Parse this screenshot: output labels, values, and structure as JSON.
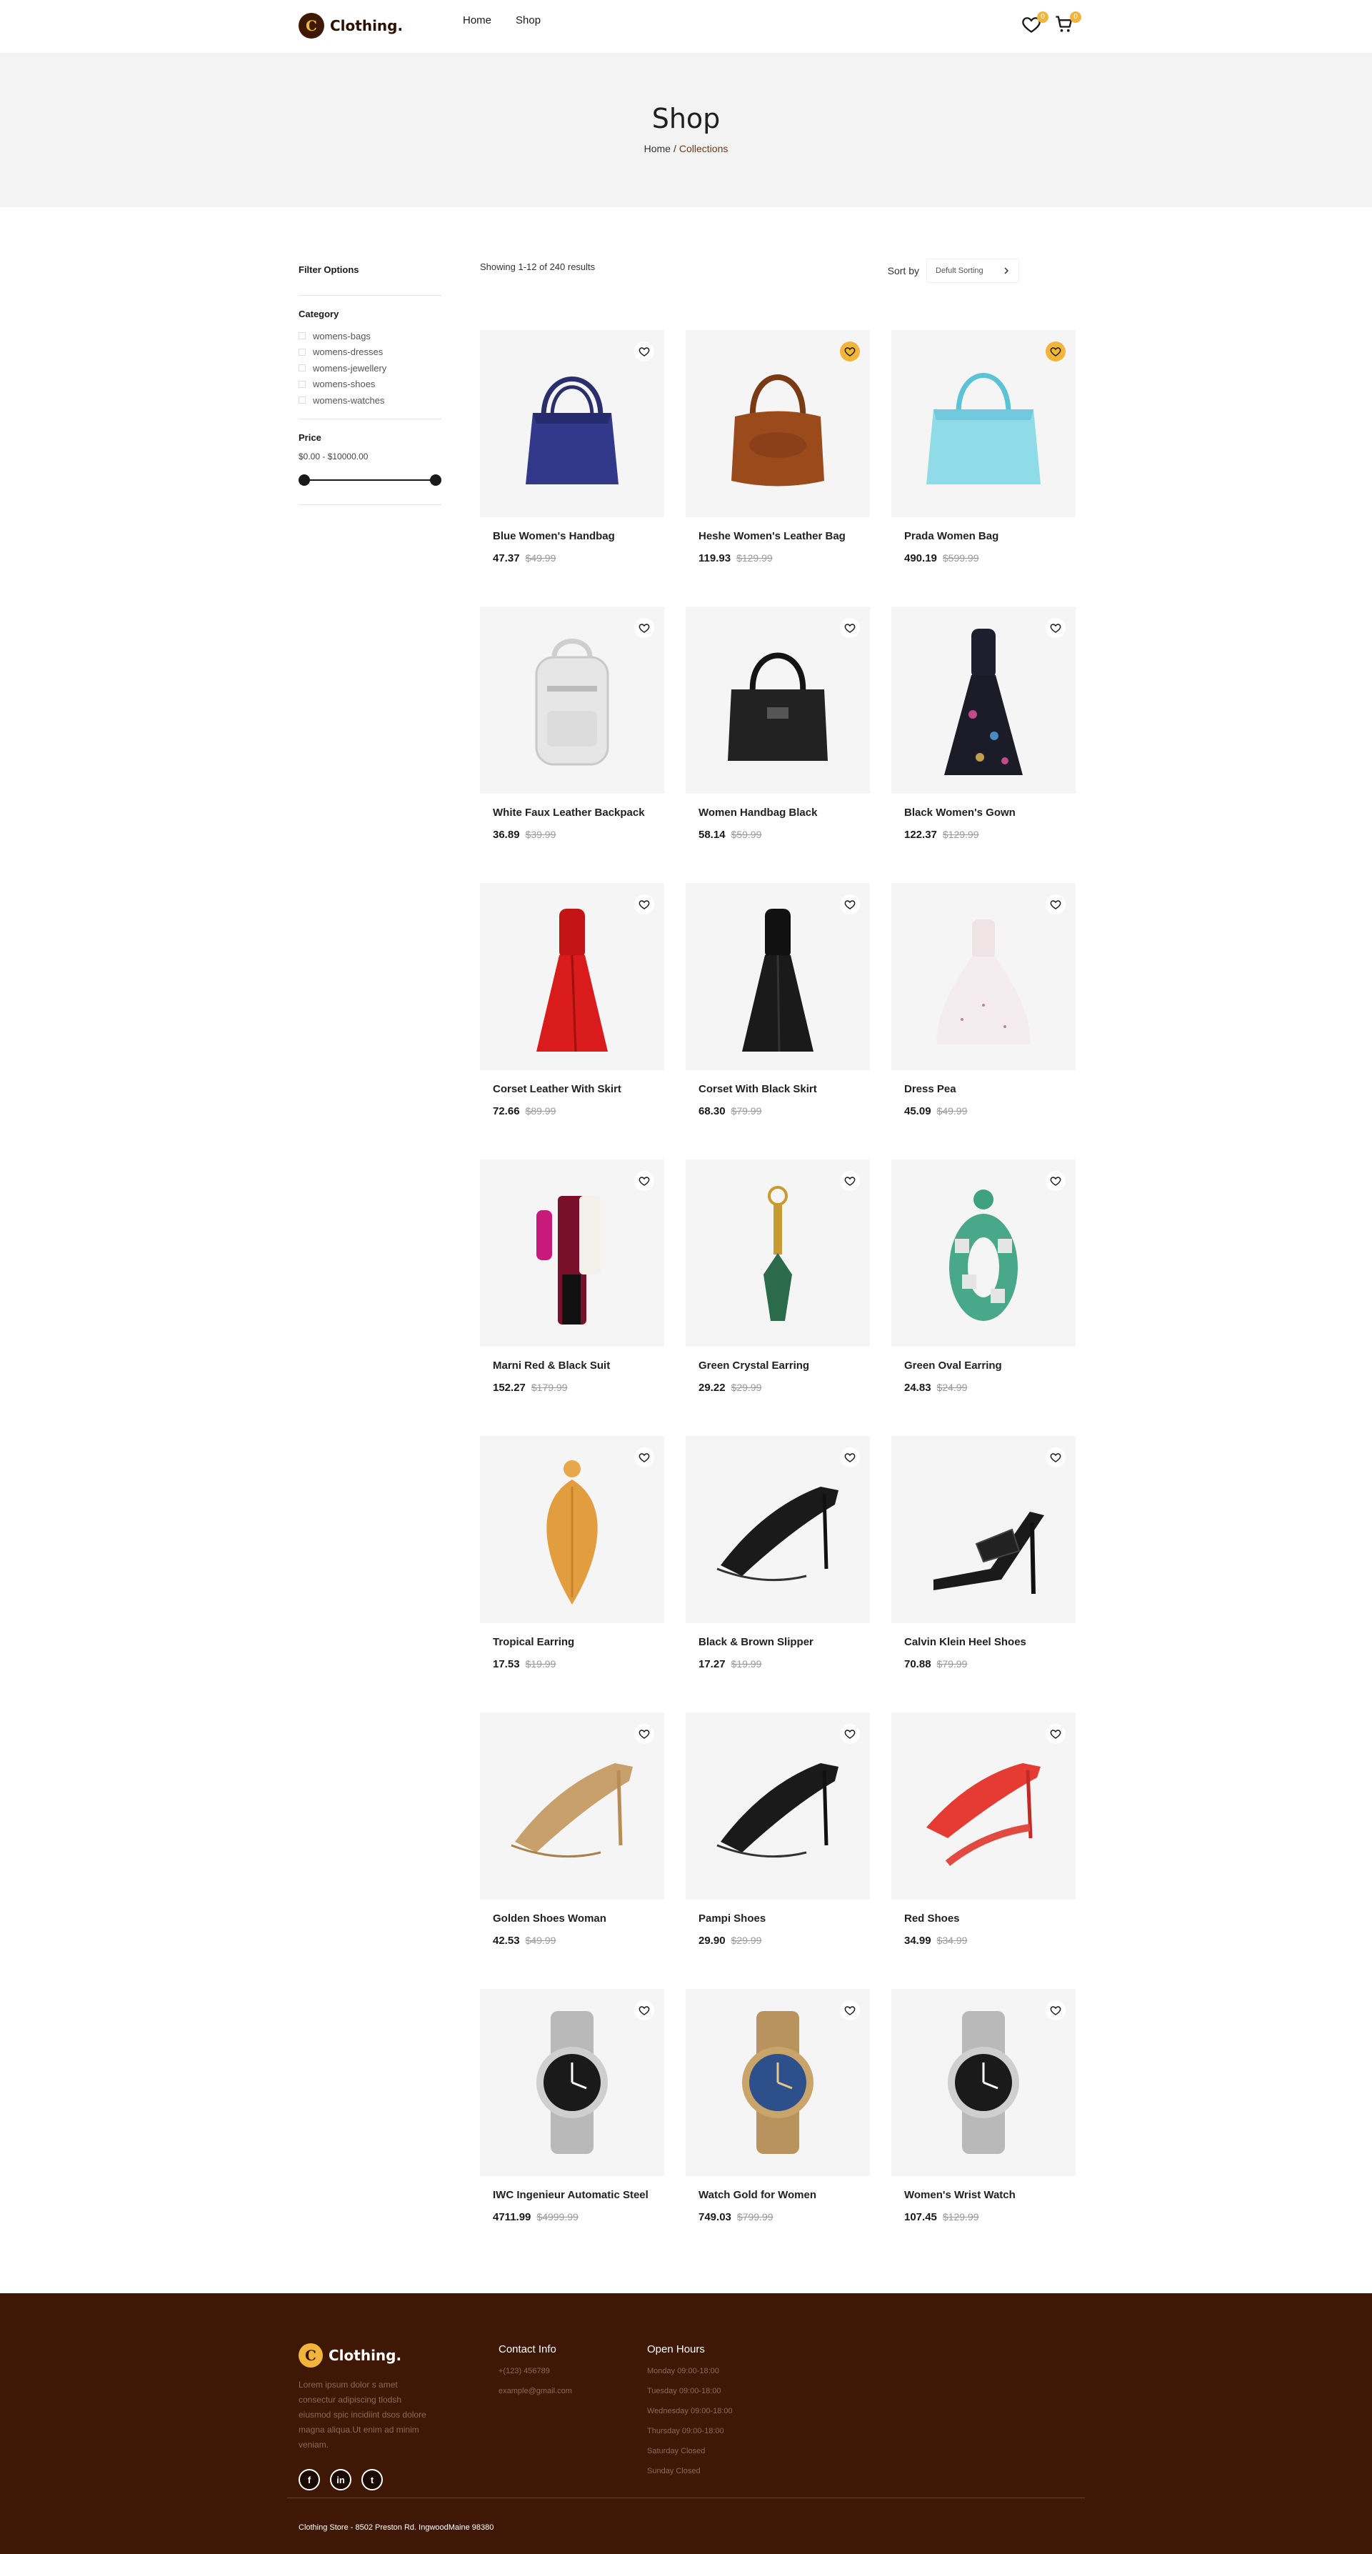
{
  "header": {
    "logo_letter": "C",
    "logo_text": "Clothing.",
    "nav": [
      "Home",
      "Shop"
    ],
    "wishlist_count": "0",
    "cart_count": "0"
  },
  "hero": {
    "title": "Shop",
    "breadcrumb": [
      "Home",
      "Collections"
    ]
  },
  "sidebar": {
    "title": "Filter Options",
    "category_heading": "Category",
    "categories": [
      "womens-bags",
      "womens-dresses",
      "womens-jewellery",
      "womens-shoes",
      "womens-watches"
    ],
    "price_heading": "Price",
    "price_range": "$0.00 - $10000.00"
  },
  "toolbar": {
    "results": "Showing 1-12 of 240 results",
    "sort_label": "Sort by",
    "sort_value": "Defult Sorting"
  },
  "products": [
    {
      "name": "Blue Women's Handbag",
      "price": "47.37",
      "old": "$49.99",
      "wish": false,
      "icon": "handbag-blue"
    },
    {
      "name": "Heshe Women's Leather Bag",
      "price": "119.93",
      "old": "$129.99",
      "wish": true,
      "icon": "handbag-brown"
    },
    {
      "name": "Prada Women Bag",
      "price": "490.19",
      "old": "$599.99",
      "wish": true,
      "icon": "handbag-aqua"
    },
    {
      "name": "White Faux Leather Backpack",
      "price": "36.89",
      "old": "$39.99",
      "wish": false,
      "icon": "backpack-white"
    },
    {
      "name": "Women Handbag Black",
      "price": "58.14",
      "old": "$59.99",
      "wish": false,
      "icon": "handbag-black"
    },
    {
      "name": "Black Women's Gown",
      "price": "122.37",
      "old": "$129.99",
      "wish": false,
      "icon": "gown-floral"
    },
    {
      "name": "Corset Leather With Skirt",
      "price": "72.66",
      "old": "$89.99",
      "wish": false,
      "icon": "dress-red"
    },
    {
      "name": "Corset With Black Skirt",
      "price": "68.30",
      "old": "$79.99",
      "wish": false,
      "icon": "dress-black"
    },
    {
      "name": "Dress Pea",
      "price": "45.09",
      "old": "$49.99",
      "wish": false,
      "icon": "dress-white"
    },
    {
      "name": "Marni Red & Black Suit",
      "price": "152.27",
      "old": "$179.99",
      "wish": false,
      "icon": "suit-red"
    },
    {
      "name": "Green Crystal Earring",
      "price": "29.22",
      "old": "$29.99",
      "wish": false,
      "icon": "earring-green"
    },
    {
      "name": "Green Oval Earring",
      "price": "24.83",
      "old": "$24.99",
      "wish": false,
      "icon": "earring-oval"
    },
    {
      "name": "Tropical Earring",
      "price": "17.53",
      "old": "$19.99",
      "wish": false,
      "icon": "earring-leaf"
    },
    {
      "name": "Black & Brown Slipper",
      "price": "17.27",
      "old": "$19.99",
      "wish": false,
      "icon": "heels-black"
    },
    {
      "name": "Calvin Klein Heel Shoes",
      "price": "70.88",
      "old": "$79.99",
      "wish": false,
      "icon": "sandal-black"
    },
    {
      "name": "Golden Shoes Woman",
      "price": "42.53",
      "old": "$49.99",
      "wish": false,
      "icon": "heels-gold"
    },
    {
      "name": "Pampi Shoes",
      "price": "29.90",
      "old": "$29.99",
      "wish": false,
      "icon": "heels-black"
    },
    {
      "name": "Red Shoes",
      "price": "34.99",
      "old": "$34.99",
      "wish": false,
      "icon": "heels-red"
    },
    {
      "name": "IWC Ingenieur Automatic Steel",
      "price": "4711.99",
      "old": "$4999.99",
      "wish": false,
      "icon": "watch-steel"
    },
    {
      "name": "Watch Gold for Women",
      "price": "749.03",
      "old": "$799.99",
      "wish": false,
      "icon": "watch-gold"
    },
    {
      "name": "Women's Wrist Watch",
      "price": "107.45",
      "old": "$129.99",
      "wish": false,
      "icon": "watch-steel"
    }
  ],
  "footer": {
    "logo_text": "Clothing.",
    "description": "Lorem ipsum dolor s amet consectur adipiscing tlodsh eiusmod spic incidiint dsos dolore magna aliqua.Ut enim ad minim veniam.",
    "socials": [
      "f",
      "in",
      "t"
    ],
    "contact_heading": "Contact Info",
    "contact": [
      "+(123) 456789",
      "example@gmail.com"
    ],
    "hours_heading": "Open Hours",
    "hours": [
      "Monday 09:00-18:00",
      "Tuesday 09:00-18:00",
      "Wednesday 09:00-18:00",
      "Thursday 09:00-18:00",
      "Saturday Closed",
      "Sunday Closed"
    ],
    "copyright": "Clothing Store - 8502 Preston Rd. IngwoodMaine 98380"
  },
  "colors": {
    "brand_dark": "#3e1805",
    "accent": "#f2b53b",
    "card_bg": "#f5f5f5"
  }
}
